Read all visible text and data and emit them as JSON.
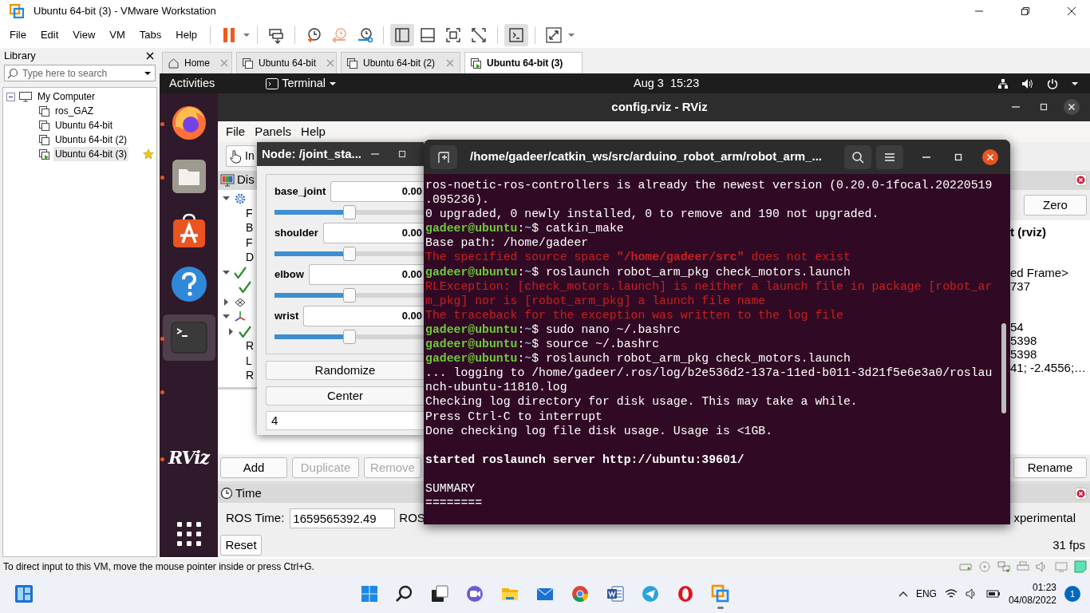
{
  "window": {
    "title": "Ubuntu 64-bit (3) - VMware Workstation"
  },
  "menu": [
    "File",
    "Edit",
    "View",
    "VM",
    "Tabs",
    "Help"
  ],
  "toolbar": [
    {
      "kind": "pause",
      "pressed": false
    },
    {
      "kind": "sendkeys",
      "pressed": false
    },
    {
      "kind": "snapshot",
      "pressed": false
    },
    {
      "kind": "revert",
      "pressed": false
    },
    {
      "kind": "manage",
      "pressed": false
    },
    {
      "kind": "library",
      "pressed": true
    },
    {
      "kind": "thumbs",
      "pressed": false
    },
    {
      "kind": "fullscreen",
      "pressed": false
    },
    {
      "kind": "unity",
      "pressed": false
    },
    {
      "kind": "console",
      "pressed": true
    },
    {
      "kind": "stretch",
      "pressed": false
    }
  ],
  "library": {
    "title": "Library",
    "search": {
      "placeholder": "Type here to search"
    },
    "tree": [
      {
        "label": "My Computer",
        "expanded": true,
        "children": [
          {
            "label": "ros_GAZ",
            "selected": false,
            "running": false,
            "favorite": false
          },
          {
            "label": "Ubuntu 64-bit",
            "selected": false,
            "running": false,
            "favorite": false
          },
          {
            "label": "Ubuntu 64-bit (2)",
            "selected": false,
            "running": false,
            "favorite": false
          },
          {
            "label": "Ubuntu 64-bit (3)",
            "selected": true,
            "running": true,
            "favorite": true
          }
        ]
      }
    ]
  },
  "tabs": [
    {
      "label": "Home",
      "kind": "home",
      "selected": false
    },
    {
      "label": "Ubuntu 64-bit",
      "kind": "vm",
      "selected": false
    },
    {
      "label": "Ubuntu 64-bit (2)",
      "kind": "vm",
      "selected": false
    },
    {
      "label": "Ubuntu 64-bit (3)",
      "kind": "vm",
      "selected": true
    }
  ],
  "ubuntu_bar": {
    "activities": "Activities",
    "app": "Terminal",
    "clock": "Aug 3  15:23"
  },
  "dock": [
    {
      "kind": "firefox",
      "running": true,
      "active": false
    },
    {
      "kind": "files",
      "running": true,
      "active": false
    },
    {
      "kind": "software",
      "running": false,
      "active": false
    },
    {
      "kind": "help",
      "running": false,
      "active": false
    },
    {
      "kind": "terminal",
      "running": true,
      "active": true
    },
    {
      "kind": "empty",
      "running": true,
      "active": false
    },
    {
      "kind": "rviz",
      "label": "RViz",
      "running": true,
      "active": false
    },
    {
      "kind": "apps",
      "running": false,
      "active": false
    }
  ],
  "rviz": {
    "title": "config.rviz - RViz",
    "menu": [
      "File",
      "Panels",
      "Help"
    ],
    "tool": "In",
    "displays": {
      "title": "Dis",
      "tree": [
        {
          "kind": "gear",
          "expanded": true,
          "children": [
            {
              "kind": "text",
              "label": "F"
            },
            {
              "kind": "text",
              "label": "B"
            },
            {
              "kind": "text",
              "label": "F"
            },
            {
              "kind": "text",
              "label": "D"
            }
          ]
        },
        {
          "kind": "check",
          "expanded": true,
          "children": [
            {
              "kind": "check"
            }
          ]
        },
        {
          "kind": "grid",
          "expanded": false
        },
        {
          "kind": "axes",
          "expanded": true,
          "children": [
            {
              "kind": "check",
              "expanded": false
            },
            {
              "kind": "text",
              "label": "R"
            },
            {
              "kind": "text",
              "label": "L"
            },
            {
              "kind": "text",
              "label": "R"
            }
          ]
        }
      ]
    },
    "display_buttons": [
      {
        "label": "Add",
        "disabled": false
      },
      {
        "label": "Duplicate",
        "disabled": true
      },
      {
        "label": "Remove",
        "disabled": true
      }
    ],
    "views": {
      "zero": "Zero",
      "groups": [
        {
          "bold": true,
          "lines": [
            "t (rviz)"
          ]
        },
        {
          "bold": false,
          "lines": [
            "ed Frame>",
            "737"
          ]
        },
        {
          "bold": false,
          "lines": [
            "54",
            "5398",
            "5398",
            "41; -2.4556;…"
          ]
        }
      ],
      "rename": "Rename"
    },
    "time": {
      "title": "Time",
      "ros_time_label": "ROS Time:",
      "ros_time": "1659565392.49",
      "cut_label": "ROS",
      "right_text": "xperimental",
      "reset": "Reset",
      "fps": "31 fps"
    }
  },
  "joint_window": {
    "title": "Node: /joint_sta...",
    "joints": [
      {
        "name": "base_joint",
        "value": "0.00",
        "level": 0.5
      },
      {
        "name": "shoulder",
        "value": "0.00",
        "level": 0.5
      },
      {
        "name": "elbow",
        "value": "0.00",
        "level": 0.5
      },
      {
        "name": "wrist",
        "value": "0.00",
        "level": 0.5
      }
    ],
    "buttons": [
      "Randomize",
      "Center"
    ],
    "count": "4"
  },
  "terminal": {
    "title": "/home/gadeer/catkin_ws/src/arduino_robot_arm/robot_arm_...",
    "lines": [
      {
        "kind": "output",
        "text": "ros-noetic-ros-controllers is already the newest version (0.20.0-1focal.20220519"
      },
      {
        "kind": "output",
        "text": ".095236)."
      },
      {
        "kind": "output",
        "text": "0 upgraded, 0 newly installed, 0 to remove and 190 not upgraded."
      },
      {
        "kind": "prompt",
        "user": "gadeer@ubuntu",
        "sep": ":",
        "path": "~",
        "sign": "$",
        "command": "catkin_make"
      },
      {
        "kind": "output",
        "text": "Base path: /home/gadeer"
      },
      {
        "kind": "error",
        "text": "The specified source space **\"/home/gadeer/src\"** does not exist"
      },
      {
        "kind": "prompt",
        "user": "gadeer@ubuntu",
        "sep": ":",
        "path": "~",
        "sign": "$",
        "command": "roslaunch robot_arm_pkg check_motors.launch"
      },
      {
        "kind": "error",
        "text": "RLException: [check_motors.launch] is neither a launch file in package [robot_ar"
      },
      {
        "kind": "error",
        "text": "m_pkg] nor is [robot_arm_pkg] a launch file name"
      },
      {
        "kind": "error",
        "text": "The traceback for the exception was written to the log file"
      },
      {
        "kind": "prompt",
        "user": "gadeer@ubuntu",
        "sep": ":",
        "path": "~",
        "sign": "$",
        "command": "sudo nano ~/.bashrc"
      },
      {
        "kind": "prompt",
        "user": "gadeer@ubuntu",
        "sep": ":",
        "path": "~",
        "sign": "$",
        "command": "source ~/.bashrc"
      },
      {
        "kind": "prompt",
        "user": "gadeer@ubuntu",
        "sep": ":",
        "path": "~",
        "sign": "$",
        "command": "roslaunch robot_arm_pkg check_motors.launch"
      },
      {
        "kind": "output",
        "text": "... logging to /home/gadeer/.ros/log/b2e536d2-137a-11ed-b011-3d21f5e6e3a0/roslau"
      },
      {
        "kind": "output",
        "text": "nch-ubuntu-11810.log"
      },
      {
        "kind": "output",
        "text": "Checking log directory for disk usage. This may take a while."
      },
      {
        "kind": "output",
        "text": "Press Ctrl-C to interrupt"
      },
      {
        "kind": "output",
        "text": "Done checking log file disk usage. Usage is <1GB."
      },
      {
        "kind": "blank"
      },
      {
        "kind": "bold",
        "text": "started roslaunch server http://ubuntu:39601/"
      },
      {
        "kind": "blank"
      },
      {
        "kind": "output",
        "text": "SUMMARY"
      },
      {
        "kind": "output",
        "text": "========"
      }
    ]
  },
  "status_bar": {
    "text": "To direct input to this VM, move the mouse pointer inside or press Ctrl+G."
  },
  "taskbar": {
    "apps": [
      {
        "kind": "start",
        "active": false
      },
      {
        "kind": "search",
        "active": false
      },
      {
        "kind": "taskview",
        "active": false
      },
      {
        "kind": "chat",
        "active": false
      },
      {
        "kind": "explorer",
        "active": false
      },
      {
        "kind": "mail",
        "active": false
      },
      {
        "kind": "chrome",
        "active": false
      },
      {
        "kind": "word",
        "active": false
      },
      {
        "kind": "telegram",
        "active": false
      },
      {
        "kind": "opera",
        "active": false
      },
      {
        "kind": "vmware",
        "active": true
      }
    ],
    "tray": {
      "language": "ENG",
      "time": "01:23",
      "date": "04/08/2022",
      "notifications": "1"
    }
  }
}
